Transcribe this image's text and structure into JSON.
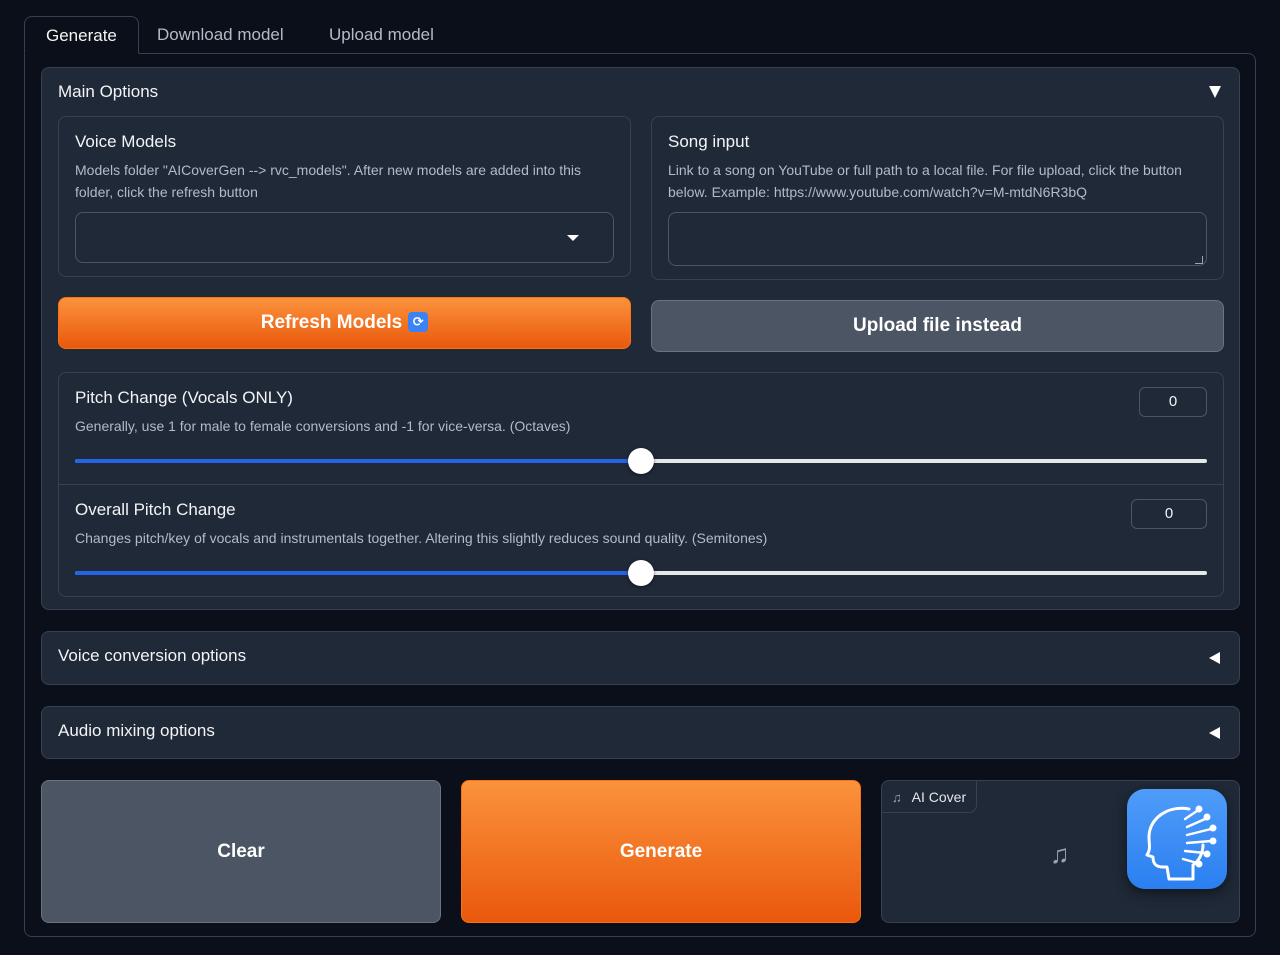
{
  "tabs": [
    "Generate",
    "Download model",
    "Upload model"
  ],
  "main_options": {
    "title": "Main Options",
    "voice_models": {
      "label": "Voice Models",
      "info_line1": "Models folder \"AICoverGen --> rvc_models\". After new models are added into this",
      "info_line2": "folder, click the refresh button",
      "selected": ""
    },
    "song_input": {
      "label": "Song input",
      "info_line1": "Link to a song on YouTube or full path to a local file. For file upload, click the button",
      "info_line2": "below. Example: https://www.youtube.com/watch?v=M-mtdN6R3bQ",
      "value": ""
    },
    "refresh_button": "Refresh Models",
    "refresh_glyph": "🔁",
    "upload_button": "Upload file instead",
    "pitch_change": {
      "label": "Pitch Change (Vocals ONLY)",
      "info": "Generally, use 1 for male to female conversions and -1 for vice-versa. (Octaves)",
      "value": "0",
      "fraction": 0.5
    },
    "overall_pitch": {
      "label": "Overall Pitch Change",
      "info": "Changes pitch/key of vocals and instrumentals together. Altering this slightly reduces sound quality. (Semitones)",
      "value": "0",
      "fraction": 0.5
    }
  },
  "voice_conversion": {
    "title": "Voice conversion options"
  },
  "audio_mixing": {
    "title": "Audio mixing options"
  },
  "actions": {
    "clear": "Clear",
    "generate": "Generate"
  },
  "output": {
    "label": "AI Cover",
    "label_icon": "music-note-icon",
    "placeholder_icon": "music-note-icon"
  },
  "floating_icon": "ai-head-icon",
  "colors": {
    "accent_orange": "#f97316",
    "slider_blue": "#2563eb",
    "panel_bg": "#1f2937",
    "page_bg": "#0b0f19"
  }
}
